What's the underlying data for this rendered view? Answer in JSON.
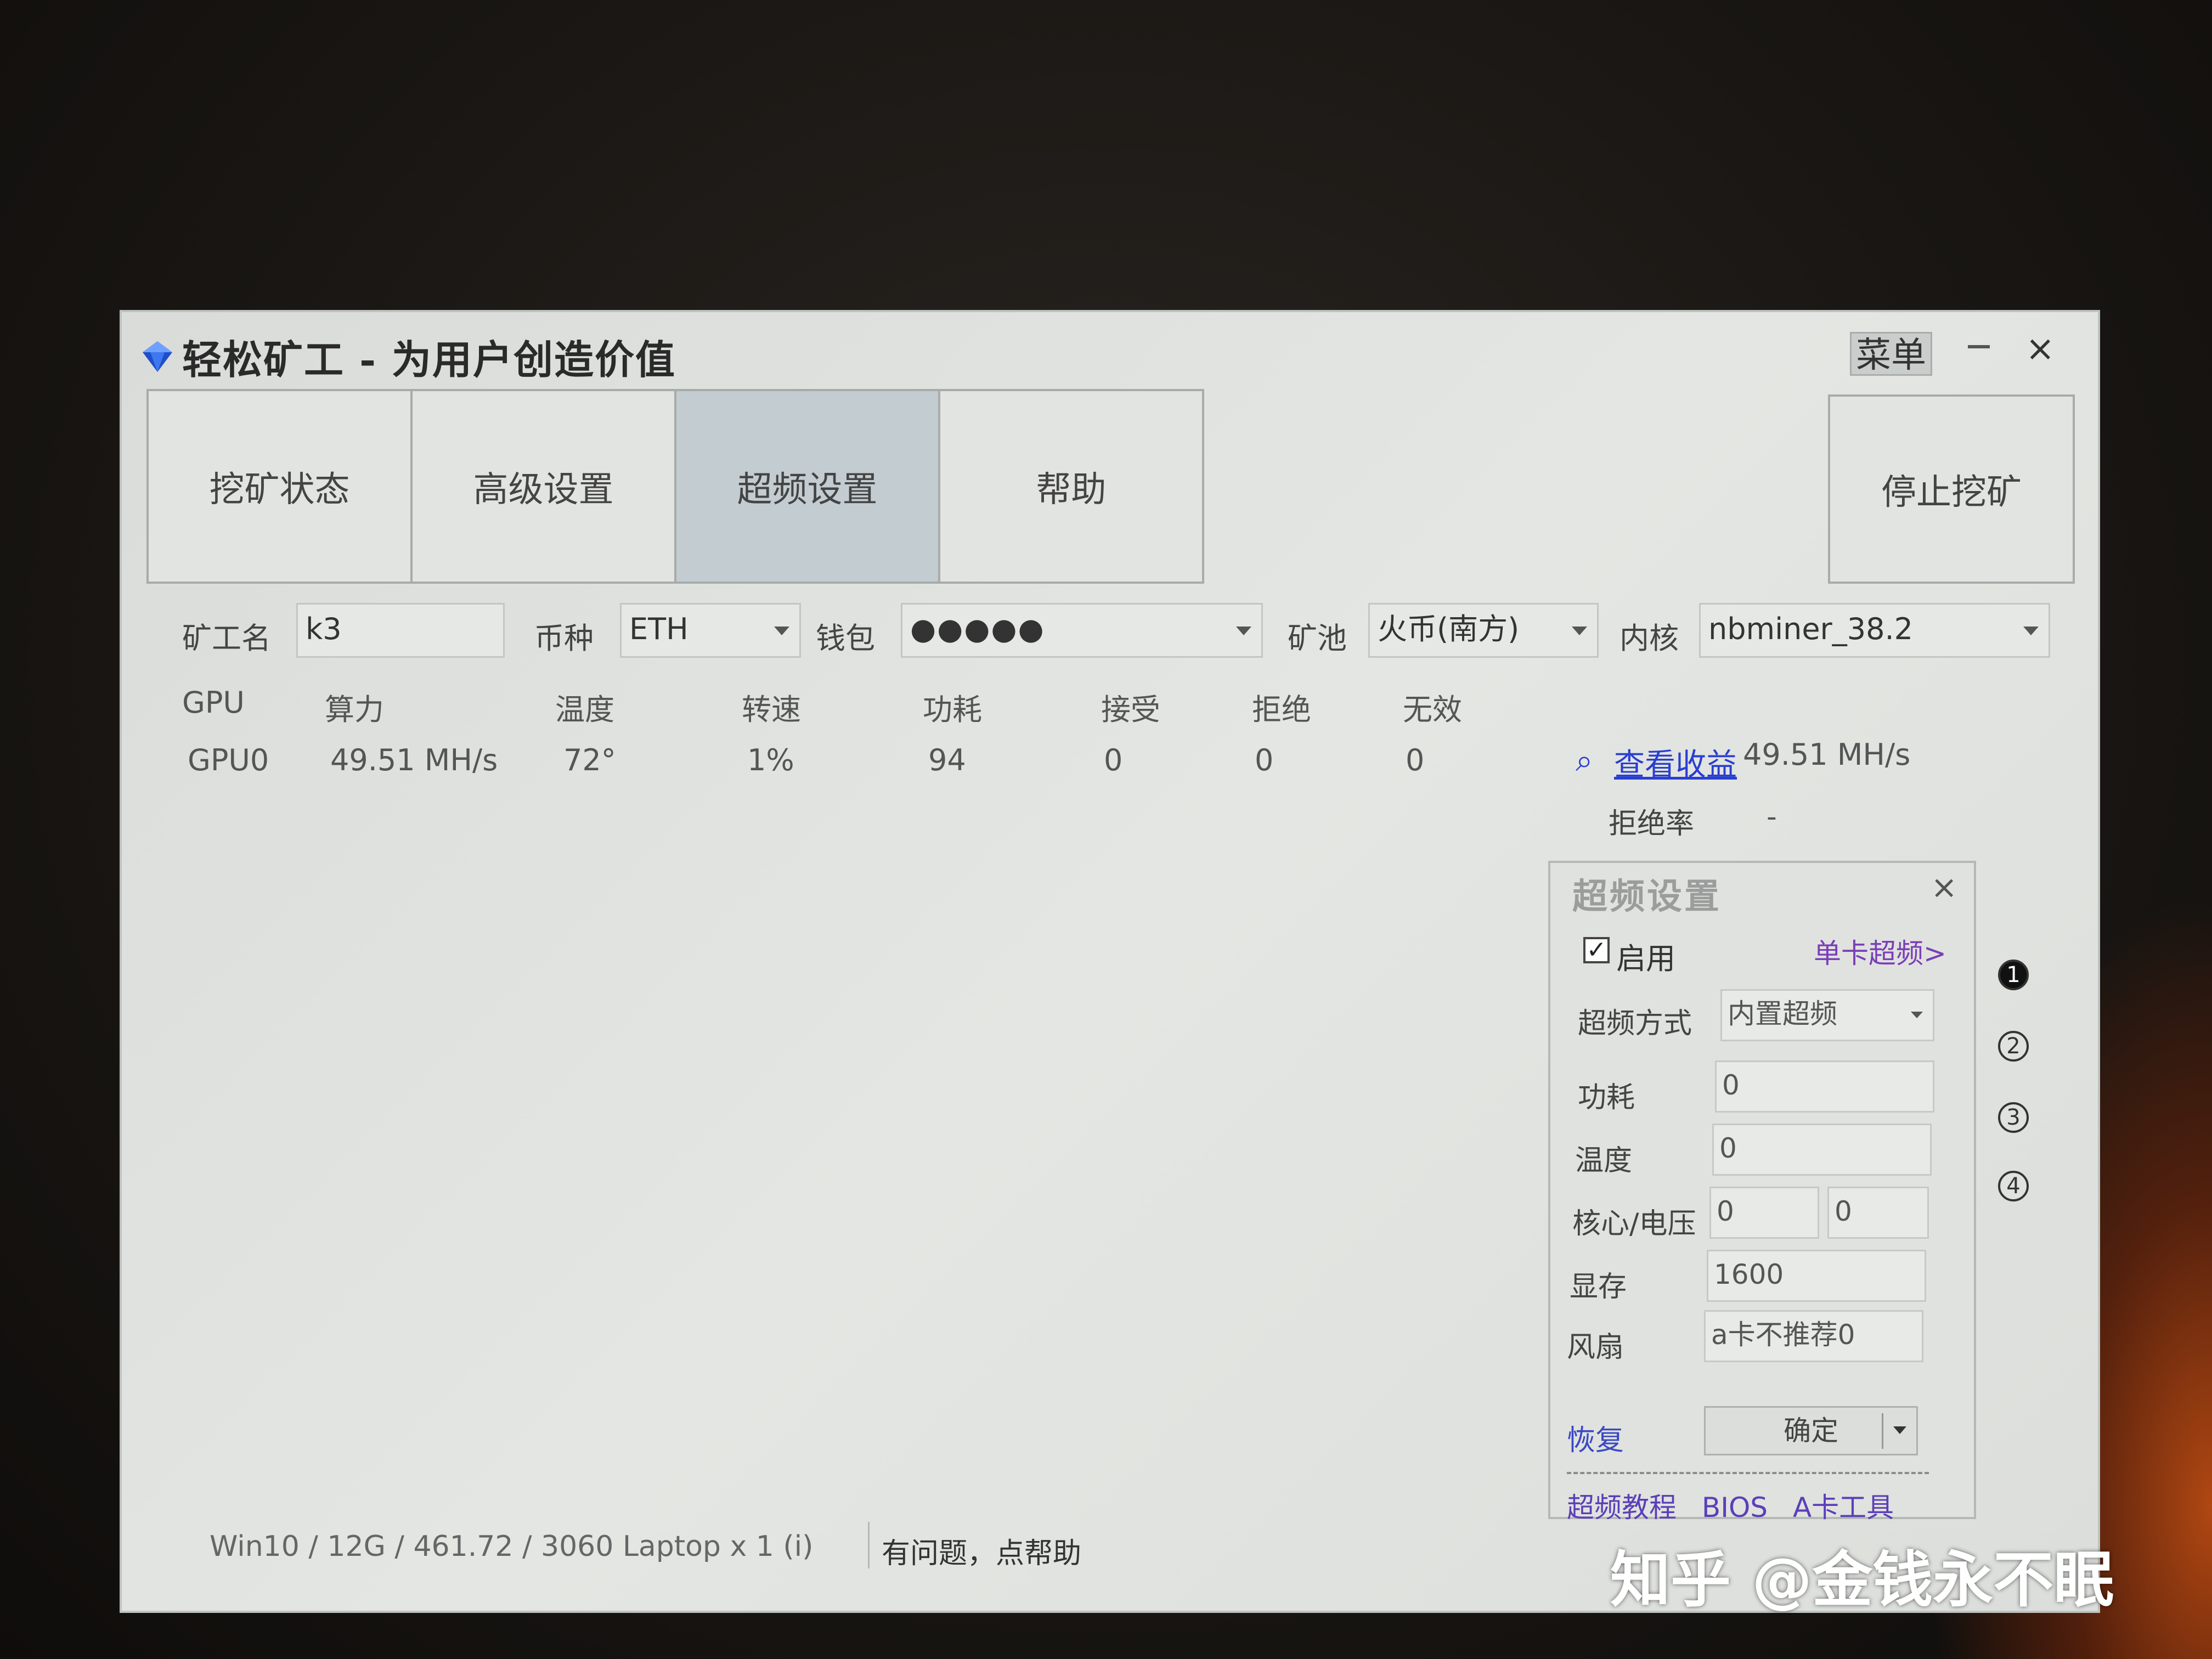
{
  "window": {
    "title": "轻松矿工 - 为用户创造价值",
    "menu_label": "菜单",
    "close_glyph": "×"
  },
  "tabs": [
    {
      "label": "挖矿状态",
      "active": false
    },
    {
      "label": "高级设置",
      "active": false
    },
    {
      "label": "超频设置",
      "active": true
    },
    {
      "label": "帮助",
      "active": false
    }
  ],
  "stop_button": "停止挖矿",
  "config": {
    "worker_label": "矿工名",
    "worker_value": "k3",
    "coin_label": "币种",
    "coin_value": "ETH",
    "wallet_label": "钱包",
    "wallet_value": "●●●●●",
    "pool_label": "矿池",
    "pool_value": "火币(南方)",
    "kernel_label": "内核",
    "kernel_value": "nbminer_38.2"
  },
  "table": {
    "headers": [
      "GPU",
      "算力",
      "温度",
      "转速",
      "功耗",
      "接受",
      "拒绝",
      "无效"
    ],
    "rows": [
      [
        "GPU0",
        "49.51 MH/s",
        "72°",
        "1%",
        "94",
        "0",
        "0",
        "0"
      ]
    ]
  },
  "earnings": {
    "icon": "search-icon",
    "link_label": "查看收益",
    "hashrate": "49.51 MH/s",
    "reject_label": "拒绝率",
    "reject_value": "-"
  },
  "oc_panel": {
    "title": "超频设置",
    "close_glyph": "×",
    "enable_label": "启用",
    "enabled": true,
    "check_glyph": "✓",
    "single_card_link": "单卡超频>",
    "mode_label": "超频方式",
    "mode_value": "内置超频",
    "power_label": "功耗",
    "power_value": "0",
    "temp_label": "温度",
    "temp_value": "0",
    "core_volt_label": "核心/电压",
    "core_value": "0",
    "volt_value": "0",
    "mem_label": "显存",
    "mem_value": "1600",
    "fan_label": "风扇",
    "fan_value": "a卡不推荐0",
    "restore_label": "恢复",
    "confirm_label": "确定",
    "bottom_links": [
      "超频教程",
      "BIOS",
      "A卡工具"
    ]
  },
  "steps": [
    "1",
    "2",
    "3",
    "4"
  ],
  "status": {
    "system_info": "Win10  / 12G / 461.72 / 3060 Laptop x 1 (i)",
    "help_text": "有问题，点帮助"
  },
  "watermark": "知乎 @金钱永不眠"
}
